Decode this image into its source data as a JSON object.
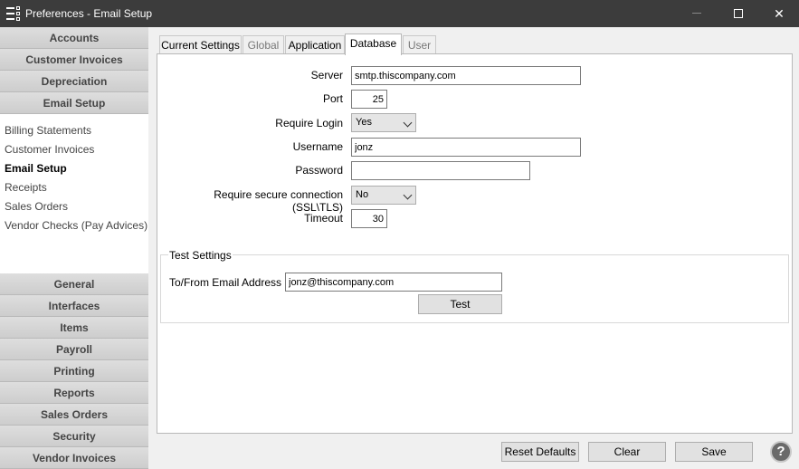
{
  "window": {
    "title": "Preferences - Email Setup",
    "minimize": "—",
    "close": "✕"
  },
  "nav": {
    "top_sections": [
      "Accounts",
      "Customer Invoices",
      "Depreciation",
      "Email Setup"
    ],
    "sub_items": [
      "Billing Statements",
      "Customer Invoices",
      "Email Setup",
      "Receipts",
      "Sales Orders",
      "Vendor Checks (Pay Advices)"
    ],
    "active_sub": "Email Setup",
    "bottom_sections": [
      "General",
      "Interfaces",
      "Items",
      "Payroll",
      "Printing",
      "Reports",
      "Sales Orders",
      "Security",
      "Vendor Invoices"
    ]
  },
  "tabs": [
    "Current Settings",
    "Global",
    "Application",
    "Database",
    "User"
  ],
  "active_tab": "Database",
  "form": {
    "server_label": "Server",
    "server_value": "smtp.thiscompany.com",
    "port_label": "Port",
    "port_value": "25",
    "login_label": "Require Login",
    "login_value": "Yes",
    "username_label": "Username",
    "username_value": "jonz",
    "password_label": "Password",
    "password_value": "",
    "ssl_label": "Require secure connection (SSL\\TLS)",
    "ssl_value": "No",
    "timeout_label": "Timeout",
    "timeout_value": "30"
  },
  "test": {
    "group_title": "Test Settings",
    "email_label": "To/From Email Address",
    "email_value": "jonz@thiscompany.com",
    "test_button": "Test"
  },
  "footer": {
    "reset_label": "Reset Defaults",
    "clear_label": "Clear",
    "save_label": "Save",
    "help": "?"
  }
}
